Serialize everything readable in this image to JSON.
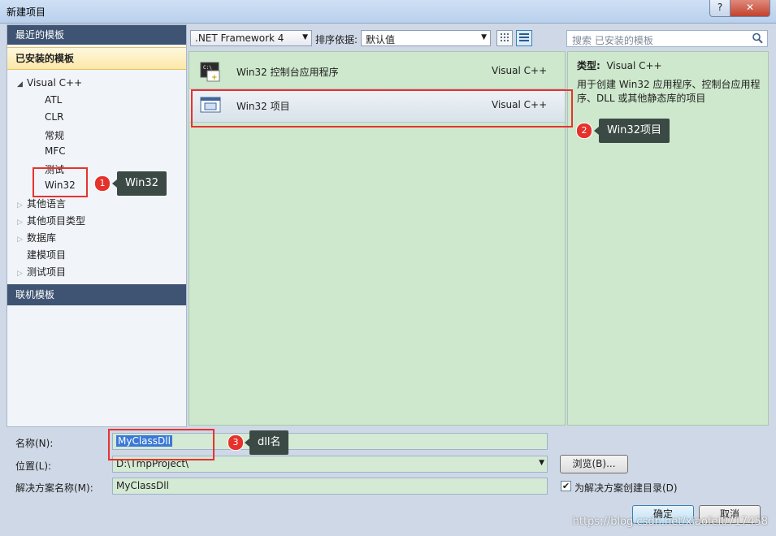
{
  "window": {
    "title": "新建项目",
    "help_label": "?",
    "close_label": "✕"
  },
  "left_panel": {
    "recent_header": "最近的模板",
    "installed_header": "已安装的模板",
    "tree": [
      {
        "label": "Visual C++",
        "expanded": true,
        "children": [
          "ATL",
          "CLR",
          "常规",
          "MFC",
          "测试",
          "Win32"
        ]
      },
      {
        "label": "其他语言"
      },
      {
        "label": "其他项目类型"
      },
      {
        "label": "数据库"
      },
      {
        "label": "建模项目"
      },
      {
        "label": "测试项目"
      }
    ],
    "online_header": "联机模板"
  },
  "toolbar": {
    "framework": ".NET Framework 4",
    "sort_label": "排序依据:",
    "sort_value": "默认值",
    "search_placeholder": "搜索 已安装的模板"
  },
  "templates": [
    {
      "name": "Win32 控制台应用程序",
      "lang": "Visual C++",
      "icon": "console-app-icon"
    },
    {
      "name": "Win32 项目",
      "lang": "Visual C++",
      "icon": "win32-project-icon",
      "selected": true
    }
  ],
  "description": {
    "type_label": "类型:",
    "type_value": "Visual C++",
    "text": "用于创建 Win32 应用程序、控制台应用程序、DLL 或其他静态库的项目"
  },
  "form": {
    "name_label": "名称(N):",
    "name_value": "MyClassDll",
    "location_label": "位置(L):",
    "location_value": "D:\\TmpProject\\",
    "solution_label": "解决方案名称(M):",
    "solution_value": "MyClassDll",
    "browse_label": "浏览(B)...",
    "create_dir_label": "为解决方案创建目录(D)",
    "create_dir_checked": true,
    "ok_label": "确定",
    "cancel_label": "取消"
  },
  "annotations": [
    {
      "num": "1",
      "text": "Win32"
    },
    {
      "num": "2",
      "text": "Win32项目"
    },
    {
      "num": "3",
      "text": "dll名"
    }
  ],
  "watermark": "https://blog.csdn.net/xiaofei0717458",
  "colors": {
    "panel_green": "#cde8cc",
    "header_navy": "#3f5472",
    "annotation_red": "#e8322f"
  }
}
